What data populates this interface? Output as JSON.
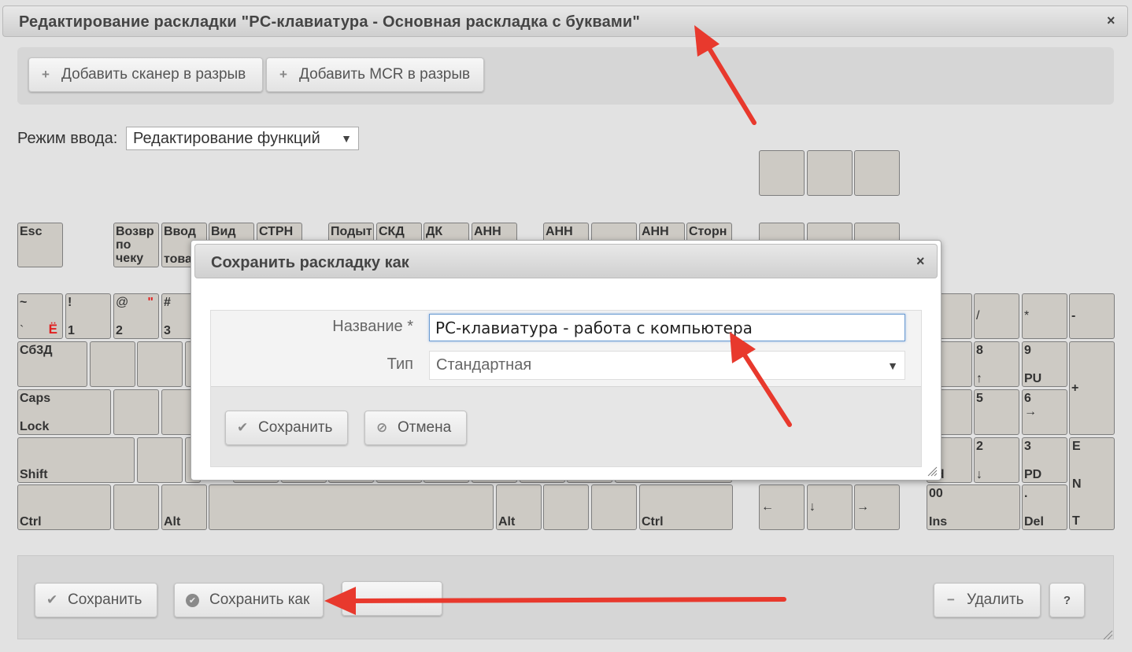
{
  "window": {
    "title": "Редактирование раскладки \"PC-клавиатура - Основная раскладка с буквами\"",
    "close": "×"
  },
  "toolbar": {
    "add_scanner": "Добавить сканер в разрыв",
    "add_mcr": "Добавить MCR в разрыв",
    "plus_icon": "+"
  },
  "mode": {
    "label": "Режим ввода:",
    "value": "Редактирование функций",
    "arrow": "▼"
  },
  "keys": {
    "esc": "Esc",
    "f1a": "Возвр",
    "f1b": "по",
    "f1c": "чеку",
    "f2a": "Ввод",
    "f2b": "това",
    "f3": "Вид",
    "f4": "СТРН",
    "f5": "Подыт",
    "f6": "СКД",
    "f7": "ДК",
    "f8": "АНН",
    "f9": "АНН",
    "f11": "АНН",
    "f12": "Сторн",
    "tilde": "~",
    "backtick": "`",
    "yo": "Ё",
    "ex": "!",
    "one": "1",
    "at": "@",
    "quote": "\"",
    "two": "2",
    "hash": "#",
    "three": "3",
    "tab": "Сб3Д",
    "caps1": "Caps",
    "caps2": "Lock",
    "shift": "Shift",
    "ctrl": "Ctrl",
    "alt": "Alt",
    "ralt": "Alt",
    "rctrl": "Ctrl",
    "left": "←",
    "down": "↓",
    "right": "→",
    "np_slash": "/",
    "np_star": "*",
    "np_minus": "-",
    "np_m": "m",
    "np_8": "8",
    "np_up": "↑",
    "np_9": "9",
    "np_pu": "PU",
    "np_plus": "+",
    "np_5": "5",
    "np_6": "6",
    "np_rarr": "→",
    "np_nd": "nd",
    "np_2": "2",
    "np_darr": "↓",
    "np_3": "3",
    "np_pd": "PD",
    "np_e": "E",
    "np_n": "N",
    "np_t": "T",
    "np_00": "00",
    "np_ins": "Ins",
    "np_dot": ".",
    "np_del": "Del"
  },
  "dialog": {
    "title": "Сохранить раскладку как",
    "close": "×",
    "name_label": "Название *",
    "name_value": "PC-клавиатура - работа с компьютера",
    "type_label": "Тип",
    "type_value": "Стандартная",
    "type_arrow": "▼",
    "save": "Сохранить",
    "cancel": "Отмена",
    "check_icon": "✔",
    "cancel_icon": "⊘"
  },
  "bottom": {
    "save": "Сохранить",
    "save_as": "Сохранить как",
    "delete": "Удалить",
    "help": "?",
    "check_icon": "✔",
    "circle_check_icon": "✔",
    "minus_icon": "−"
  },
  "colors": {
    "accent_arrow": "#e8392d",
    "key_fill": "#cdcac4",
    "input_focus": "#6a9ad0"
  }
}
